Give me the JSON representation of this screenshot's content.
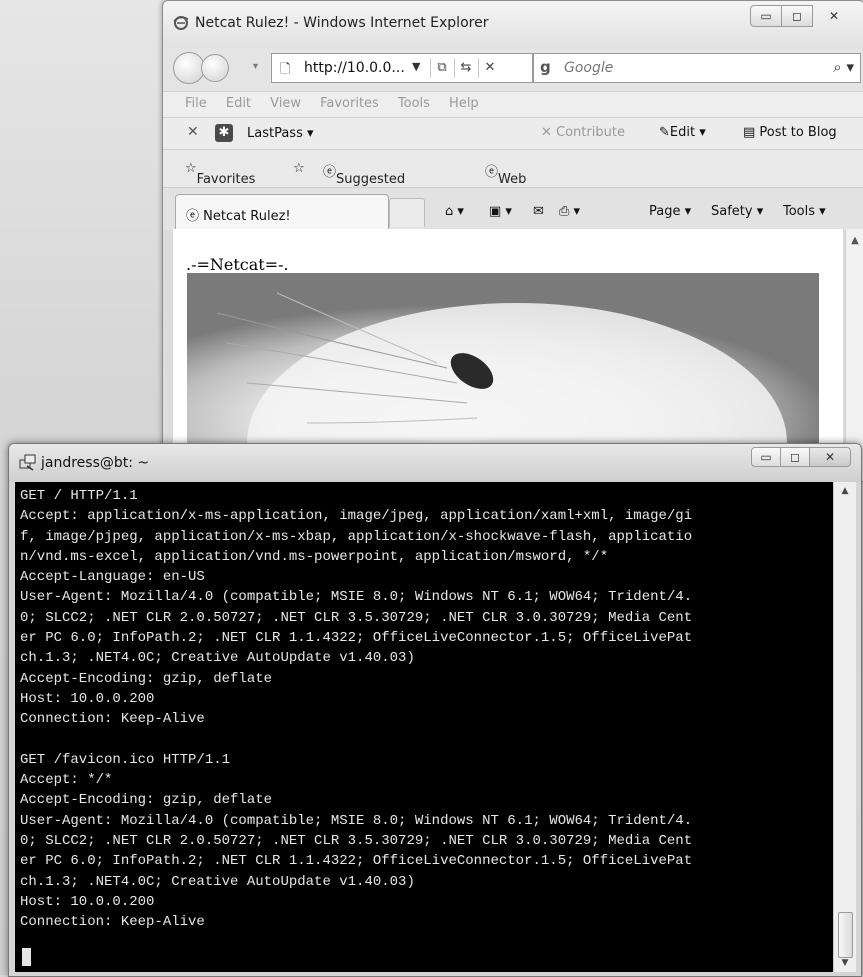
{
  "ie": {
    "title": "Netcat Rulez! - Windows Internet Explorer",
    "address": "http://10.0.0...",
    "search_placeholder": "Google",
    "menu": [
      "File",
      "Edit",
      "View",
      "Favorites",
      "Tools",
      "Help"
    ],
    "lastpass": "LastPass ▾",
    "contribute": "Contribute",
    "edit": "Edit",
    "post_to_blog": "Post to Blog",
    "favorites": "Favorites",
    "suggested_sites": "Suggested Sites ▾",
    "web_slice": "Web Slice Gallery ▾",
    "tab_title": "Netcat Rulez!",
    "page_menu": "Page ▾",
    "safety_menu": "Safety ▾",
    "tools_menu": "Tools ▾",
    "page_heading": ".-=Netcat=-."
  },
  "putty": {
    "title": "jandress@bt: ~",
    "lines": [
      "GET / HTTP/1.1",
      "Accept: application/x-ms-application, image/jpeg, application/xaml+xml, image/gi",
      "f, image/pjpeg, application/x-ms-xbap, application/x-shockwave-flash, applicatio",
      "n/vnd.ms-excel, application/vnd.ms-powerpoint, application/msword, */*",
      "Accept-Language: en-US",
      "User-Agent: Mozilla/4.0 (compatible; MSIE 8.0; Windows NT 6.1; WOW64; Trident/4.",
      "0; SLCC2; .NET CLR 2.0.50727; .NET CLR 3.5.30729; .NET CLR 3.0.30729; Media Cent",
      "er PC 6.0; InfoPath.2; .NET CLR 1.1.4322; OfficeLiveConnector.1.5; OfficeLivePat",
      "ch.1.3; .NET4.0C; Creative AutoUpdate v1.40.03)",
      "Accept-Encoding: gzip, deflate",
      "Host: 10.0.0.200",
      "Connection: Keep-Alive",
      "",
      "GET /favicon.ico HTTP/1.1",
      "Accept: */*",
      "Accept-Encoding: gzip, deflate",
      "User-Agent: Mozilla/4.0 (compatible; MSIE 8.0; Windows NT 6.1; WOW64; Trident/4.",
      "0; SLCC2; .NET CLR 2.0.50727; .NET CLR 3.5.30729; .NET CLR 3.0.30729; Media Cent",
      "er PC 6.0; InfoPath.2; .NET CLR 1.1.4322; OfficeLiveConnector.1.5; OfficeLivePat",
      "ch.1.3; .NET4.0C; Creative AutoUpdate v1.40.03)",
      "Host: 10.0.0.200",
      "Connection: Keep-Alive"
    ]
  }
}
